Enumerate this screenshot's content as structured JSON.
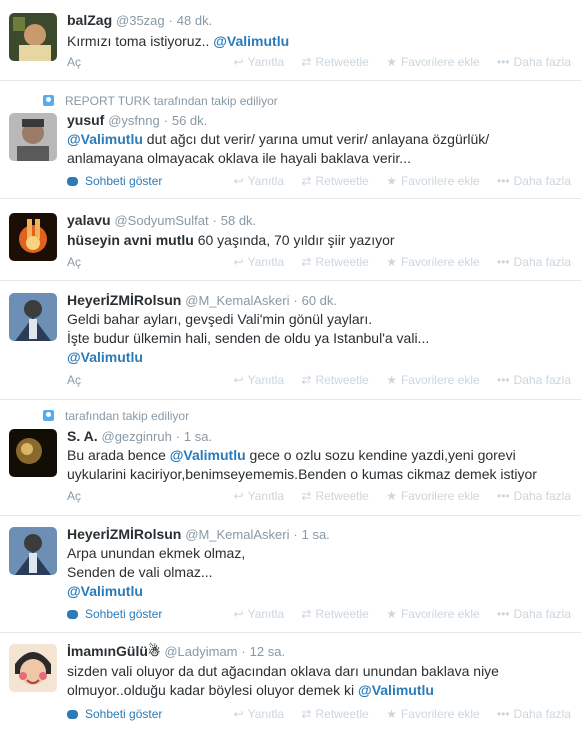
{
  "actions": {
    "reply": "Yanıtla",
    "retweet": "Retweetle",
    "favorite": "Favorilere ekle",
    "more": "Daha fazla"
  },
  "expand_label": "Aç",
  "conversation_label": "Sohbeti göster",
  "tweets": [
    {
      "name": "balZag",
      "handle": "@35zag",
      "sep": "·",
      "time": "48 dk.",
      "lines": [
        [
          {
            "t": "Kırmızı toma istiyoruz.. "
          },
          {
            "t": "@Valimutlu",
            "m": 1
          }
        ]
      ]
    },
    {
      "context": "REPORT TURK tarafından takip ediliyor",
      "name": "yusuf",
      "handle": "@ysfnng",
      "sep": "·",
      "time": "56 dk.",
      "lines": [
        [
          {
            "t": "@Valimutlu",
            "m": 1
          },
          {
            "t": " dut ağcı dut verir/ yarına umut verir/ anlayana özgürlük/"
          }
        ],
        [
          {
            "t": "anlamayana olmayacak oklava ile hayali baklava verir..."
          }
        ]
      ]
    },
    {
      "name": "yalavu",
      "handle": "@SodyumSulfat",
      "sep": "·",
      "time": "58 dk.",
      "lines": [
        [
          {
            "t": "hüseyin avni mutlu",
            "b": 1
          },
          {
            "t": " 60 yaşında, 70 yıldır şiir yazıyor"
          }
        ]
      ]
    },
    {
      "name": "HeyerİZMİRolsun",
      "handle": "@M_KemalAskeri",
      "sep": "·",
      "time": "60 dk.",
      "lines": [
        [
          {
            "t": "Geldi bahar ayları, gevşedi Vali'min gönül yayları."
          }
        ],
        [
          {
            "t": "İşte budur ülkemin hali, senden de oldu ya Istanbul'a vali..."
          }
        ],
        [
          {
            "t": "@Valimutlu",
            "m": 1
          }
        ]
      ]
    },
    {
      "context": "tarafından takip ediliyor",
      "name": "S. A.",
      "handle": "@gezginruh",
      "sep": "·",
      "time": "1 sa.",
      "lines": [
        [
          {
            "t": "Bu arada bence "
          },
          {
            "t": "@Valimutlu",
            "m": 1
          },
          {
            "t": " gece o ozlu sozu kendine yazdi,yeni gorevi"
          }
        ],
        [
          {
            "t": "uykularini kaciriyor,benimseyememis.Benden o kumas cikmaz demek istiyor"
          }
        ]
      ]
    },
    {
      "name": "HeyerİZMİRolsun",
      "handle": "@M_KemalAskeri",
      "sep": "·",
      "time": "1 sa.",
      "lines": [
        [
          {
            "t": "Arpa unundan ekmek olmaz,"
          }
        ],
        [
          {
            "t": "Senden de vali olmaz..."
          }
        ],
        [
          {
            "t": "@Valimutlu",
            "m": 1
          }
        ]
      ]
    },
    {
      "name": "İmamınGülü☃",
      "handle": "@Ladyimam",
      "sep": "·",
      "time": "12 sa.",
      "lines": [
        [
          {
            "t": "sizden vali oluyor da dut ağacından oklava darı unundan baklava niye"
          }
        ],
        [
          {
            "t": "olmuyor..olduğu kadar böylesi oluyor demek ki "
          },
          {
            "t": "@Valimutlu",
            "m": 1
          }
        ]
      ]
    }
  ]
}
